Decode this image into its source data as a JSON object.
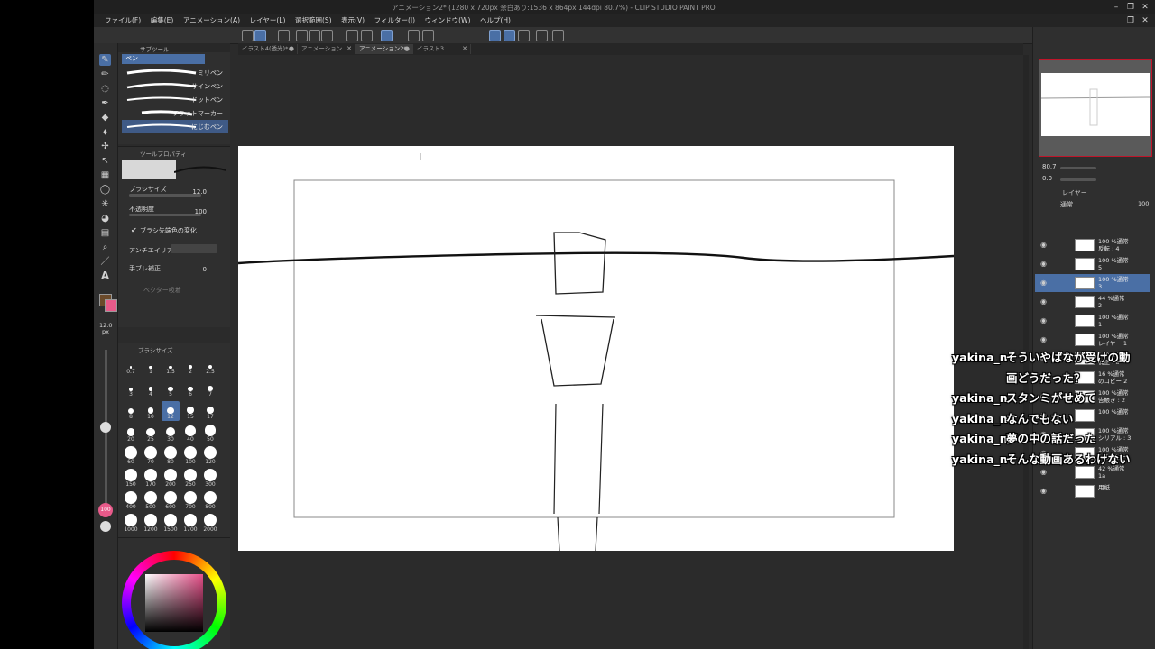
{
  "window": {
    "title": "アニメーション2* (1280 x 720px 余白あり:1536 x 864px 144dpi 80.7%) - CLIP STUDIO PAINT PRO"
  },
  "menu": [
    "ファイル(F)",
    "編集(E)",
    "アニメーション(A)",
    "レイヤー(L)",
    "選択範囲(S)",
    "表示(V)",
    "フィルター(I)",
    "ウィンドウ(W)",
    "ヘルプ(H)"
  ],
  "tabs": [
    {
      "label": "イラスト4(透光)*",
      "active": false
    },
    {
      "label": "アニメーション",
      "active": false
    },
    {
      "label": "アニメーション2*",
      "active": true
    },
    {
      "label": "イラスト3",
      "active": false
    }
  ],
  "subtool": {
    "header": "サブツール",
    "group": "ペン",
    "brushes": [
      {
        "label": "ミリペン",
        "active": false
      },
      {
        "label": "サインペン",
        "active": false
      },
      {
        "label": "ドットペン",
        "active": false
      },
      {
        "label": "フラットマーカー",
        "active": false
      },
      {
        "label": "にじむペン",
        "active": true
      }
    ]
  },
  "toolprop": {
    "header": "ツールプロパティ",
    "brush_size_label": "ブラシサイズ",
    "brush_size_value": "12.0",
    "opacity_label": "不透明度",
    "opacity_value": "100",
    "tip_change_label": "ブラシ先端色の変化",
    "antialias_label": "アンチエイリアス",
    "stabilize_label": "手ブレ補正",
    "stabilize_value": "0",
    "vector_label": "ベクター吸着"
  },
  "brushsize": {
    "header": "ブラシサイズ",
    "side_value": "12.0",
    "side_unit": "px",
    "rows": [
      [
        "0.7",
        "1",
        "1.5",
        "2",
        "2.5"
      ],
      [
        "3",
        "4",
        "5",
        "6",
        "7"
      ],
      [
        "8",
        "10",
        "12",
        "15",
        "17"
      ],
      [
        "20",
        "25",
        "30",
        "40",
        "50"
      ],
      [
        "60",
        "70",
        "80",
        "100",
        "120"
      ],
      [
        "150",
        "170",
        "200",
        "250",
        "300"
      ],
      [
        "400",
        "500",
        "600",
        "700",
        "800"
      ],
      [
        "1000",
        "1200",
        "1500",
        "1700",
        "2000"
      ]
    ],
    "selected": "12"
  },
  "left_slider_value": "100",
  "navigator": {
    "zoom": "80.7",
    "angle": "0.0"
  },
  "layers": {
    "header": "レイヤー",
    "blend": "通常",
    "opacity": "100",
    "rows": [
      {
        "line1": "100 %通常",
        "line2": "反転 : 4",
        "selected": false
      },
      {
        "line1": "100 %通常",
        "line2": "5",
        "selected": false
      },
      {
        "line1": "100 %通常",
        "line2": "3",
        "selected": true
      },
      {
        "line1": "44 %通常",
        "line2": "2",
        "selected": false
      },
      {
        "line1": "100 %通常",
        "line2": "1",
        "selected": false
      },
      {
        "line1": "100 %通常",
        "line2": "レイヤー 1",
        "selected": false
      },
      {
        "line1": "100 %通常",
        "line2": "補正 : 8",
        "selected": false
      },
      {
        "line1": "16 %通常",
        "line2": "のコピー 2",
        "selected": false
      },
      {
        "line1": "100 %通常",
        "line2": "告帳き : 2",
        "selected": false
      },
      {
        "line1": "100 %通常",
        "line2": "",
        "selected": false
      },
      {
        "line1": "100 %通常",
        "line2": "シリアル : 3",
        "selected": false
      },
      {
        "line1": "100 %通常",
        "line2": "1 のコピー",
        "selected": false
      },
      {
        "line1": "42 %通常",
        "line2": "1a",
        "selected": false
      },
      {
        "line1": "",
        "line2": "用紙",
        "selected": false
      }
    ]
  },
  "chat": [
    {
      "user": "yakina_n",
      "text": "そういやばなが受けの動"
    },
    {
      "user": "",
      "text": "画どうだった？"
    },
    {
      "user": "yakina_n",
      "text": "スタンミがせめて"
    },
    {
      "user": "yakina_n",
      "text": "なんでもない"
    },
    {
      "user": "yakina_n",
      "text": "夢の中の話だった"
    },
    {
      "user": "yakina_n",
      "text": "そんな動画あるわけない"
    }
  ],
  "colors": {
    "accent": "#4a6fa5",
    "main_color": "#6b4a2a",
    "sub_color": "#e85a8a",
    "nav_border": "#c0152a"
  }
}
